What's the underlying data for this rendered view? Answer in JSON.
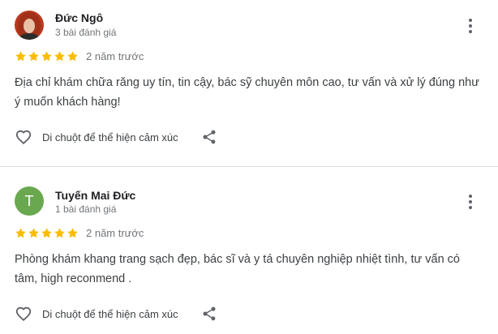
{
  "reviews": [
    {
      "name": "Đức Ngô",
      "meta": "3 bài đánh giá",
      "rating": 5,
      "time": "2 năm trước",
      "text": "Địa chỉ khám chữa răng uy tín, tin cậy, bác sỹ chuyên môn cao, tư vấn và xử lý đúng như ý muốn khách hàng!",
      "react_label": "Di chuột để thể hiện cảm xúc",
      "avatar": "photo"
    },
    {
      "name": "Tuyến Mai Đức",
      "meta": "1 bài đánh giá",
      "rating": 5,
      "time": "2 năm trước",
      "text": "Phòng khám khang trang sạch đẹp, bác sĩ và y tá chuyên nghiệp nhiệt tình, tư vấn có tâm, high reconmend .",
      "react_label": "Di chuột để thể hiện cảm xúc",
      "avatar_letter": "T"
    }
  ],
  "colors": {
    "star": "#fbbc04",
    "letter_avatar": "#6aa84f",
    "divider": "#dadce0"
  },
  "icons": [
    "more-vert-icon",
    "star-icon",
    "heart-outline-icon",
    "share-icon"
  ]
}
